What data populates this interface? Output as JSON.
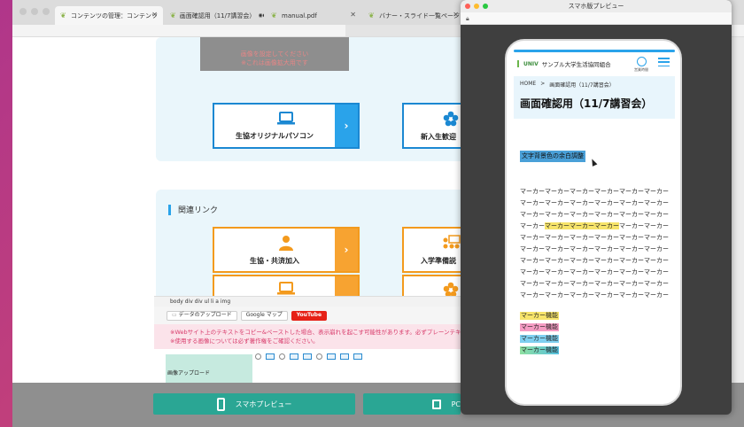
{
  "browser": {
    "tabs": [
      {
        "label": "コンテンツの管理：コンテンツ",
        "active": true
      },
      {
        "label": "画面確認用（11/7講習会）",
        "active": false
      },
      {
        "label": "manual.pdf",
        "active": false
      },
      {
        "label": "バナー・スライド一覧ページ |",
        "active": false
      }
    ]
  },
  "editor": {
    "gray_box_lines": [
      "画像を設定してください",
      "※これは画像拡大用です"
    ],
    "top_buttons": [
      {
        "label": "生協オリジナルパソコン",
        "icon": "laptop-icon",
        "color": "#1b88d2"
      },
      {
        "label": "新入生歓迎",
        "icon": "sakura-icon",
        "color": "#1b88d2"
      }
    ],
    "section_title": "関連リンク",
    "link_buttons": [
      {
        "label": "生協・共済加入",
        "icon": "person-icon",
        "color": "#f39a1d"
      },
      {
        "label": "入学準備説",
        "icon": "seminar-icon",
        "color": "#f39a1d"
      }
    ],
    "path": "body   div   div   ul   li   a   img",
    "file_upload": "データのアップロード",
    "google_maps": "Google マップ",
    "youtube": "YouTube",
    "notice_lines": [
      "※Webサイト上のテキストをコピー&ペーストした場合、表示崩れを起こす可能性があります。必ずプレーンテキストに変換",
      "※使用する画像については必ず著作権をご確認ください。"
    ],
    "image_upload_label": "画像アップロード"
  },
  "bottom": {
    "sp_preview": "スマホプレビュー",
    "pc_preview": "PC"
  },
  "preview": {
    "window_title": "スマホ版プレビュー",
    "site_name": "サンプル大学生活協同組合",
    "logo_text": "UNIV",
    "hours_label": "営業時間",
    "breadcrumb_home": "HOME",
    "breadcrumb_sep": ">",
    "breadcrumb_current": "画面確認用（11/7講習会）",
    "page_title": "画面確認用（11/7講習会）",
    "selected_text": "文字背景色の余白調整",
    "marker_lines": [
      {
        "before": "マーカーマーカーマーカーマーカーマーカーマーカー",
        "mark": "",
        "after": ""
      },
      {
        "before": "マーカーマーカーマーカーマーカーマーカーマーカー",
        "mark": "",
        "after": ""
      },
      {
        "before": "マーカーマーカーマーカーマーカーマーカーマーカー",
        "mark": "",
        "after": ""
      },
      {
        "before": "マーカー",
        "mark": "マーカーマーカーマーカー",
        "after": "マーカーマーカー"
      },
      {
        "before": "マーカーマーカーマーカーマーカーマーカーマーカー",
        "mark": "",
        "after": ""
      },
      {
        "before": "マーカーマーカーマーカーマーカーマーカーマーカー",
        "mark": "",
        "after": ""
      },
      {
        "before": "マーカーマーカーマーカーマーカーマーカーマーカー",
        "mark": "",
        "after": ""
      },
      {
        "before": "マーカーマーカーマーカーマーカーマーカーマーカー",
        "mark": "",
        "after": ""
      },
      {
        "before": "マーカーマーカーマーカーマーカーマーカーマーカー",
        "mark": "",
        "after": ""
      },
      {
        "before": "マーカーマーカーマーカーマーカーマーカーマーカー",
        "mark": "",
        "after": ""
      },
      {
        "before": "マーカーマーカーマーカーマーカーマーカーマーカー",
        "mark": "",
        "after": ""
      }
    ],
    "marker_features": [
      {
        "label": "マーカー機能",
        "color": "#f7e46a"
      },
      {
        "label": "マーカー機能",
        "color": "#f59cc4"
      },
      {
        "label": "マーカー機能",
        "color": "#7fd0f0"
      },
      {
        "label": "マーカー機能",
        "color": "#8fe0a0"
      }
    ]
  }
}
